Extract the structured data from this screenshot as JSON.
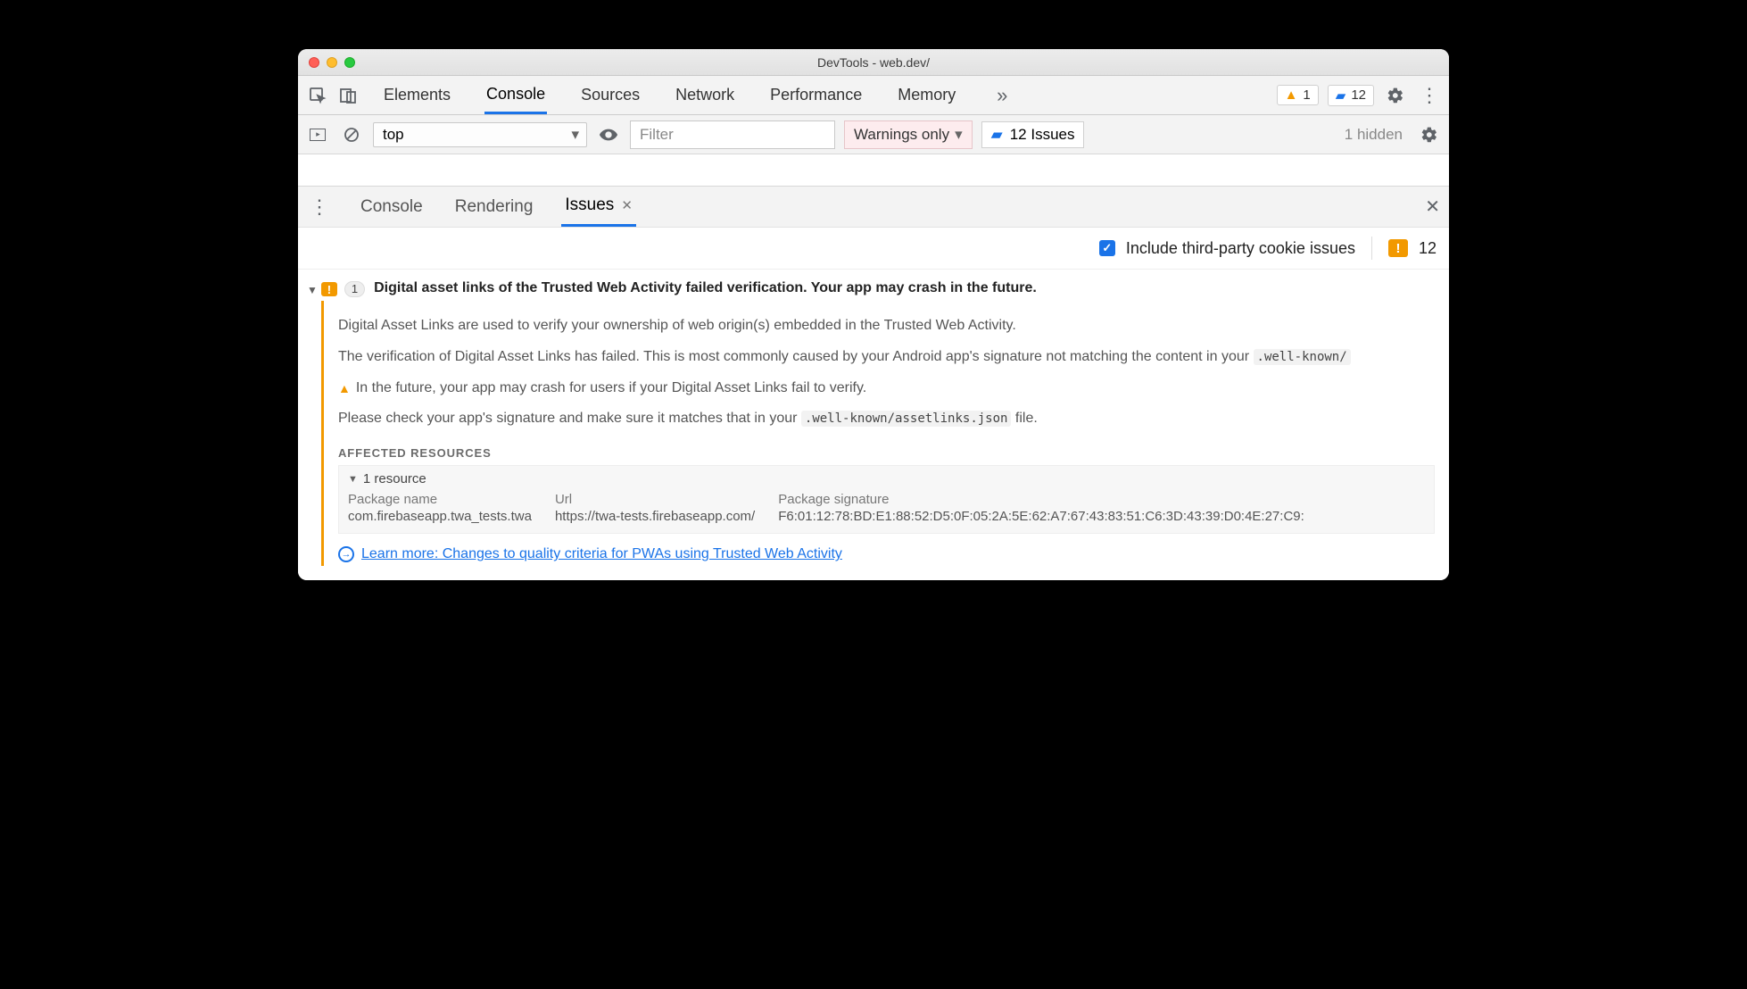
{
  "window": {
    "title": "DevTools - web.dev/"
  },
  "toolbar": {
    "tabs": [
      "Elements",
      "Console",
      "Sources",
      "Network",
      "Performance",
      "Memory"
    ],
    "active_tab_index": 1,
    "warnings_badge": "1",
    "issues_badge": "12"
  },
  "filter_bar": {
    "context": "top",
    "filter_placeholder": "Filter",
    "level": "Warnings only",
    "issues_chip": "12 Issues",
    "hidden": "1 hidden"
  },
  "drawer": {
    "tabs": [
      "Console",
      "Rendering",
      "Issues"
    ],
    "active_tab_index": 2
  },
  "issues_header": {
    "checkbox_label": "Include third-party cookie issues",
    "count": "12"
  },
  "issue": {
    "count_pill": "1",
    "title": "Digital asset links of the Trusted Web Activity failed verification. Your app may crash in the future.",
    "p1": "Digital Asset Links are used to verify your ownership of web origin(s) embedded in the Trusted Web Activity.",
    "p2_a": "The verification of Digital Asset Links has failed. This is most commonly caused by your Android app's signature not matching the content in your ",
    "p2_code": ".well-known/",
    "p3": "In the future, your app may crash for users if your Digital Asset Links fail to verify.",
    "p4_a": "Please check your app's signature and make sure it matches that in your ",
    "p4_code": ".well-known/assetlinks.json",
    "p4_b": " file.",
    "affected_heading": "AFFECTED RESOURCES",
    "resource_summary": "1 resource",
    "table": {
      "headers": [
        "Package name",
        "Url",
        "Package signature"
      ],
      "row": [
        "com.firebaseapp.twa_tests.twa",
        "https://twa-tests.firebaseapp.com/",
        "F6:01:12:78:BD:E1:88:52:D5:0F:05:2A:5E:62:A7:67:43:83:51:C6:3D:43:39:D0:4E:27:C9:"
      ]
    },
    "learn_more": "Learn more: Changes to quality criteria for PWAs using Trusted Web Activity"
  }
}
